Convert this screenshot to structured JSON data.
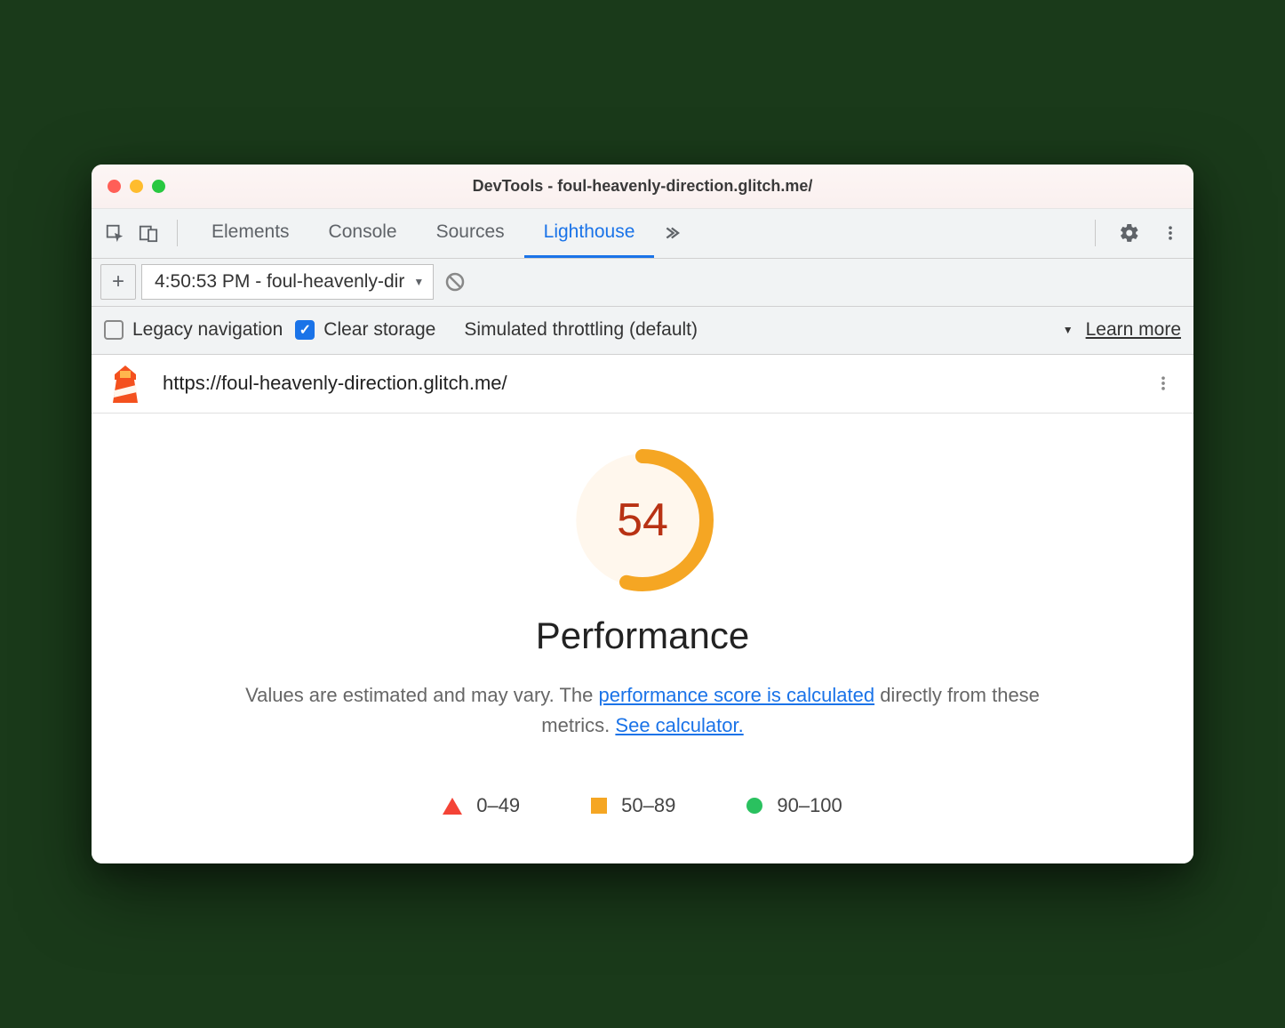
{
  "window": {
    "title": "DevTools - foul-heavenly-direction.glitch.me/"
  },
  "tabs": {
    "items": [
      "Elements",
      "Console",
      "Sources",
      "Lighthouse"
    ],
    "active_index": 3
  },
  "subbar": {
    "report_label": "4:50:53 PM - foul-heavenly-dir"
  },
  "options": {
    "legacy_label": "Legacy navigation",
    "legacy_checked": false,
    "clear_label": "Clear storage",
    "clear_checked": true,
    "throttling_label": "Simulated throttling (default)",
    "learn_more": "Learn more"
  },
  "urlbar": {
    "url": "https://foul-heavenly-direction.glitch.me/"
  },
  "report": {
    "score": "54",
    "score_pct": 54,
    "title": "Performance",
    "desc_prefix": "Values are estimated and may vary. The ",
    "desc_link1": "performance score is calculated",
    "desc_mid": " directly from these metrics. ",
    "desc_link2": "See calculator.",
    "legend": {
      "range1": "0–49",
      "range2": "50–89",
      "range3": "90–100"
    }
  },
  "colors": {
    "accent": "#1a73e8",
    "score_arc": "#f5a623",
    "score_text": "#b83214"
  }
}
